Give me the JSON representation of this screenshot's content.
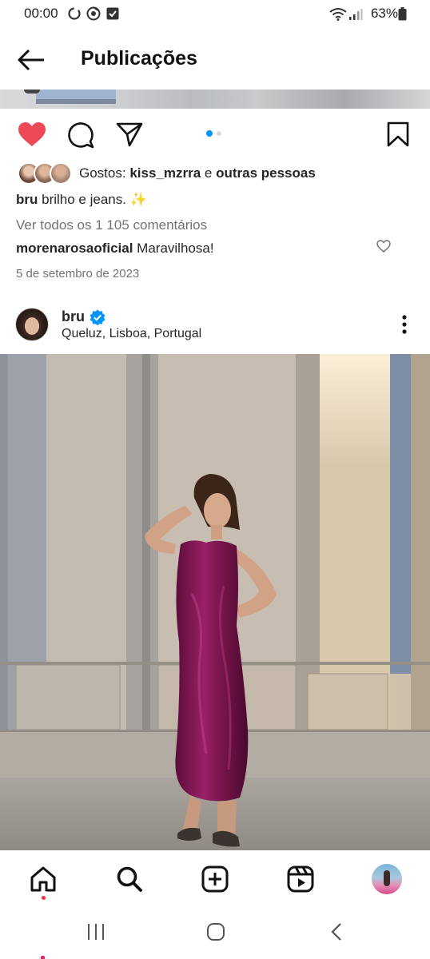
{
  "status_bar": {
    "time": "00:00",
    "battery": "63%",
    "icons": [
      "sync-icon",
      "chrome-icon",
      "checkbox-icon",
      "wifi-icon",
      "signal-icon",
      "battery-icon"
    ]
  },
  "header": {
    "title": "Publicações",
    "back_icon": "back-arrow-icon"
  },
  "previous_post": {
    "liked": true,
    "likes_prefix": "Gostos: ",
    "likes_user": "kiss_mzrra",
    "likes_mid": " e ",
    "likes_suffix": "outras pessoas",
    "caption_user": "bru",
    "caption_text": " brilho e jeans. ✨",
    "view_comments": "Ver todos os 1 105 comentários",
    "comment_user": "morenarosaoficial",
    "comment_text": " Maravilhosa!",
    "date": "5 de setembro de 2023",
    "carousel_dots": 2,
    "active_dot": 0,
    "colors": {
      "like": "#ed4956",
      "active_dot": "#0095f6",
      "inactive_dot": "#dbdbdb"
    }
  },
  "next_post": {
    "username": "bru",
    "verified": true,
    "location": "Queluz, Lisboa, Portugal",
    "more_icon": "more-vertical-icon",
    "colors": {
      "verified": "#0095f6",
      "dress": "#7d1550"
    }
  },
  "bottom_nav": {
    "items": [
      "home-icon",
      "search-icon",
      "new-post-icon",
      "reels-icon",
      "profile-avatar"
    ]
  },
  "system_nav": {
    "items": [
      "recent-apps-icon",
      "home-button-icon",
      "back-button-icon"
    ]
  }
}
